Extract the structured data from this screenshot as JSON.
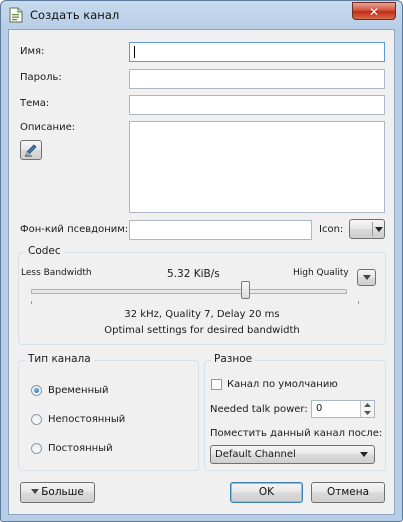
{
  "window": {
    "title": "Создать канал",
    "close_glyph": "✕"
  },
  "fields": {
    "name_label": "Имя:",
    "password_label": "Пароль:",
    "topic_label": "Тема:",
    "description_label": "Описание:",
    "phonetic_label": "Фон-кий псевдоним:",
    "icon_label": "Icon:"
  },
  "codec": {
    "group_title": "Codec",
    "left_label": "Less Bandwidth",
    "rate_value": "5.32 KiB/s",
    "right_label": "High Quality",
    "quality_fraction": 0.68,
    "details": "32 kHz, Quality 7, Delay 20 ms",
    "hint": "Optimal settings for desired bandwidth"
  },
  "channel_type": {
    "group_title": "Тип канала",
    "options": [
      "Временный",
      "Непостоянный",
      "Постоянный"
    ],
    "selected": "Временный"
  },
  "misc": {
    "group_title": "Разное",
    "default_channel_label": "Канал по умолчанию",
    "default_channel_checked": false,
    "talk_power_label": "Needed talk power:",
    "talk_power_value": "0",
    "place_after_label": "Поместить данный канал после:",
    "place_after_value": "Default Channel"
  },
  "buttons": {
    "more": "Больше",
    "ok": "OK",
    "cancel": "Отмена"
  },
  "colors": {
    "title_bar": "#b7cde6",
    "close_button": "#c12d17",
    "dialog_bg": "#f0f0f0",
    "focus_border": "#5b9bd5"
  },
  "icons": {
    "app": "document-icon",
    "edit": "pen-icon",
    "dropdown": "chevron-down-icon",
    "more": "triangle-down-icon"
  }
}
